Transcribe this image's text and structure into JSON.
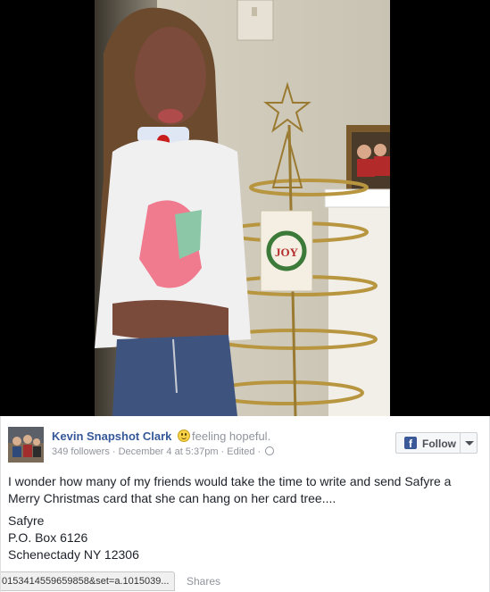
{
  "post": {
    "author_name": "Kevin Snapshot Clark",
    "feeling_icon": "smiley-icon",
    "feeling_text": "feeling hopeful.",
    "followers": "349 followers",
    "meta_sep1": " · ",
    "date": "December 4 at 5:37pm",
    "meta_sep2": " · ",
    "edited": "Edited",
    "meta_sep3": " · ",
    "privacy_icon": "globe-icon",
    "follow_label": "Follow",
    "text": "I wonder how many of my friends would take the time to write and send Safyre a Merry Christmas card that she can hang on her card tree....",
    "address": {
      "name": "Safyre",
      "box": "P.O. Box 6126",
      "city": "Schenectady NY 12306"
    },
    "shares_label": "Shares"
  },
  "photo_card": {
    "label": "JOY"
  },
  "statusbar": {
    "url": "0153414559659858&set=a.1015039..."
  },
  "colors": {
    "link": "#365899",
    "meta": "#90949c",
    "text": "#1d2129",
    "facebook_blue": "#3b5998"
  }
}
